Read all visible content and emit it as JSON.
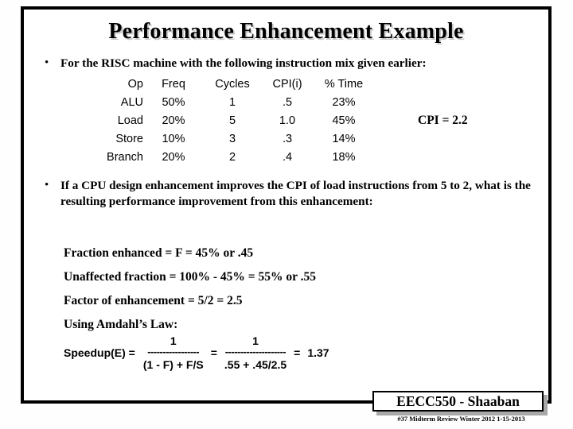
{
  "slide": {
    "title": "Performance Enhancement Example",
    "bullets": [
      {
        "marker": "•",
        "text": "For the RISC machine with the following instruction mix given earlier:"
      },
      {
        "marker": "•",
        "text": "If a CPU design enhancement improves the CPI of load instructions from 5 to 2,  what is the resulting performance improvement from this enhancement:"
      }
    ],
    "instruction_mix": {
      "headers": [
        "Op",
        "Freq",
        "Cycles",
        "CPI(i)",
        "% Time"
      ],
      "rows": [
        [
          "ALU",
          "50%",
          "1",
          ".5",
          "23%"
        ],
        [
          "Load",
          "20%",
          "5",
          "1.0",
          "45%"
        ],
        [
          "Store",
          "10%",
          "3",
          ".3",
          "14%"
        ],
        [
          "Branch",
          "20%",
          "2",
          ".4",
          "18%"
        ]
      ],
      "note": "CPI = 2.2"
    },
    "solution": {
      "line1": "Fraction enhanced =  F =  45%  or .45",
      "line2": "Unaffected fraction = 100% - 45% =  55%   or .55",
      "line3": "Factor of enhancement =  5/2 =  2.5",
      "line4": "Using Amdahl’s Law:"
    },
    "speedup": {
      "label": "Speedup(E)  =",
      "equals_1": "=",
      "equals_2": "=",
      "frac1_numerator": "1",
      "frac1_bar": "-----------------",
      "frac1_denominator": "(1 - F)  +  F/S",
      "frac2_numerator": "1",
      "frac2_bar": "--------------------",
      "frac2_denominator": ".55  +  .45/2.5",
      "result": "1.37"
    },
    "footer": {
      "badge": "EECC550 - Shaaban",
      "subtext": "#37   Midterm Review  Winter 2012  1-15-2013"
    }
  }
}
